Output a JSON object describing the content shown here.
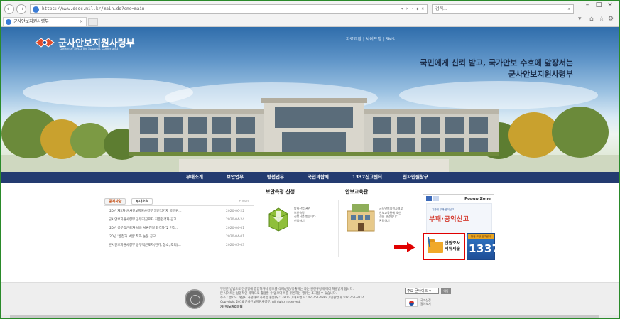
{
  "browser": {
    "back_glyph": "←",
    "forward_glyph": "→",
    "url": "https://www.dssc.mil.kr/main.do?cmd=main",
    "addr_controls": "▾ × · ◆ ×",
    "search_placeholder": "검색...",
    "search_icon": "⌕",
    "tab_title": "군사안보지원사령부",
    "tab_close": "×",
    "win_min": "–",
    "win_max": "□",
    "win_close": "×",
    "search_dropdown": "▾",
    "home_icon": "⌂",
    "favorites_icon": "☆",
    "settings_icon": "⚙"
  },
  "header": {
    "logo_kr": "군사안보지원사령부",
    "logo_en": "Defense Security Support Command",
    "util_links": "자료교환 | 사이트맵 | SMS",
    "slogan_line1": "국민에게 신뢰 받고, 국가안보 수호에 앞장서는",
    "slogan_line2": "군사안보지원사령부"
  },
  "nav": {
    "items": [
      "부대소개",
      "보안업무",
      "방첩업무",
      "국민과함께",
      "1337신고센터",
      "전자민원창구"
    ]
  },
  "news": {
    "tab_notice": "공지사항",
    "tab_unit": "부대소식",
    "more": "+ more",
    "rows": [
      {
        "title": "· '20년 제2차 군사안보지원사령부 일반임기제 공무원...",
        "date": "2020-06-22"
      },
      {
        "title": "· 군사안보지원사령부 공무직근로자 최종합격자 공고",
        "date": "2020-04-24"
      },
      {
        "title": "· '20년 공무직근로자 채용 서류전형 합격자 및 면접...",
        "date": "2020-04-01"
      },
      {
        "title": "· '20년 '방첩과 보안' 책자 논문 공모",
        "date": "2020-04-01"
      },
      {
        "title": "· 군사안보지원사령부 공무직근로자(전기, 청소, 조리)...",
        "date": "2020-03-03"
      }
    ]
  },
  "security_measure": {
    "title": "보안측정 신청",
    "desc": [
      "방위산업 관련",
      "보안측정",
      "신청서를 받습니다.",
      "신청하기"
    ]
  },
  "education": {
    "title": "안보교육관",
    "desc": [
      "군사안보지원사령부",
      "안보교육관에 오신",
      "것을 환영합니다.",
      "관람하기"
    ]
  },
  "popup_zone": {
    "title": "Popup Zone",
    "sub": "기관내 부패·공익신고",
    "banner": "부패·공익신고"
  },
  "apply_button": {
    "line1": "신원조사",
    "line2": "서류제출"
  },
  "banner_1337": {
    "top": "방첩·보안 신고센터",
    "number": "1337"
  },
  "footer": {
    "line1": "무단한 방법으로 전산망에 침입하거나 정보를 삭제/변경/유출하는 자는 관련규정에 따라 처벌받게 됩니다.",
    "line2": "본 사이트는 상업적인 목적으로 활용할 수 없으며 이를 위반하는 행위는 조치될 수 있습니다.",
    "line3": "주소 : 경기도 과천시 과천대로 사서함 홍분(우:13806) / 대표번호 : 02-751-4889 / 민원안내 : 02-751-3714",
    "line4": "Copyright 2016 군사안보지원사령부. All rights reserved.",
    "line5": "개인정보처리방침",
    "site_select": "주요 군사이트 ∨",
    "go": "이동",
    "flag_text": [
      "국가상징",
      "알아보기"
    ]
  },
  "colors": {
    "nav_bg": "#233b70",
    "accent_red": "#e00000",
    "frame_green": "#2a8a2a"
  }
}
